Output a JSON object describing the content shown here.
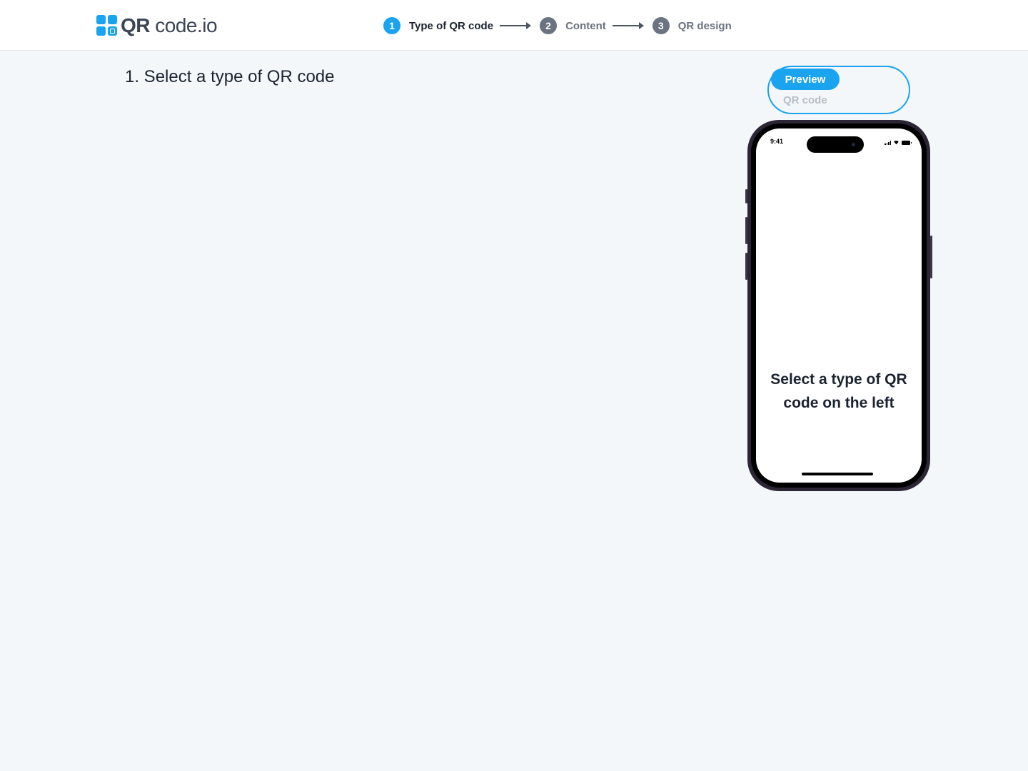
{
  "header": {
    "logo": {
      "brand_bold": "QR",
      "brand_rest": " code.io"
    },
    "steps": [
      {
        "number": "1",
        "label": "Type of QR code",
        "state": "active"
      },
      {
        "number": "2",
        "label": "Content",
        "state": "inactive"
      },
      {
        "number": "3",
        "label": "QR design",
        "state": "inactive"
      }
    ]
  },
  "main": {
    "title": "1. Select a type of QR code"
  },
  "preview_panel": {
    "toggle": {
      "preview_label": "Preview",
      "qr_label": "QR code",
      "selected": "Preview"
    },
    "phone": {
      "status_time": "9:41",
      "message": "Select a type of QR code on the left"
    }
  },
  "colors": {
    "accent": "#1aa3ee",
    "background": "#f3f7fa",
    "text_dark": "#1b2330",
    "step_inactive": "#6b7280"
  }
}
